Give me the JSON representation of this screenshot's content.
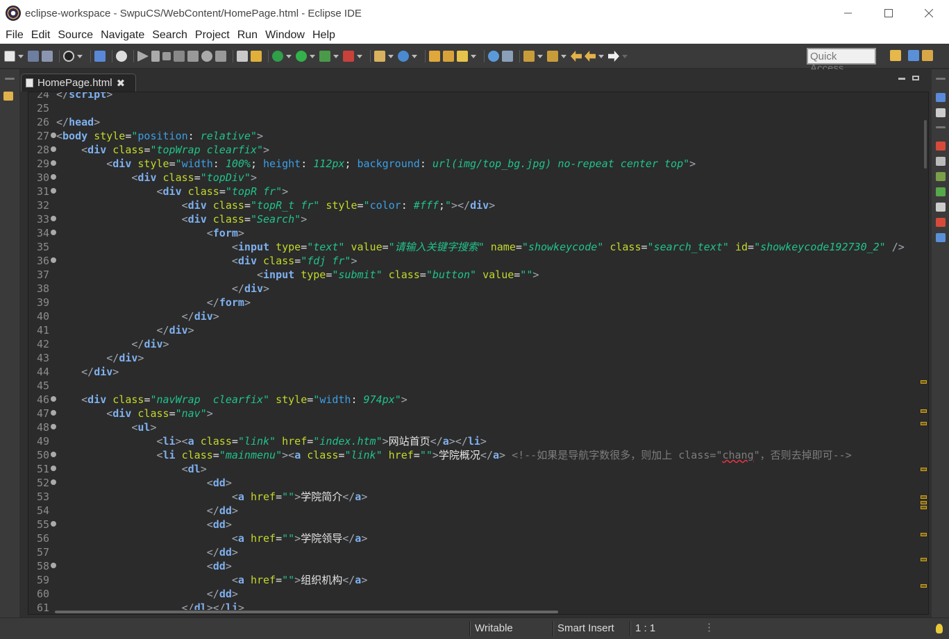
{
  "window": {
    "title": "eclipse-workspace - SwpuCS/WebContent/HomePage.html - Eclipse IDE",
    "icon": "eclipse-icon"
  },
  "menu": [
    "File",
    "Edit",
    "Source",
    "Navigate",
    "Search",
    "Project",
    "Run",
    "Window",
    "Help"
  ],
  "toolbar": {
    "quick_access_placeholder": "Quick Access"
  },
  "editor": {
    "tab_label": "HomePage.html",
    "tab_close": "✖",
    "lines": [
      {
        "n": "24",
        "fold": false,
        "html": "<span class='t'>&lt;/</span><span class='tn'>script</span><span class='t'>&gt;</span>"
      },
      {
        "n": "25",
        "fold": false,
        "html": ""
      },
      {
        "n": "26",
        "fold": false,
        "html": "<span class='t'>&lt;/</span><span class='tn'>head</span><span class='t'>&gt;</span>"
      },
      {
        "n": "27",
        "fold": true,
        "html": "<span class='t'>&lt;</span><span class='tn'>body</span> <span class='an'>style</span><span class='tx'>=</span><span class='av'>\"</span><span class='css'>position</span><span class='tx'>: </span><span class='av'>relative</span><span class='av'>\"</span><span class='t'>&gt;</span>"
      },
      {
        "n": "28",
        "fold": true,
        "html": "    <span class='t'>&lt;</span><span class='tn'>div</span> <span class='an'>class</span><span class='tx'>=</span><span class='av'>\"topWrap clearfix\"</span><span class='t'>&gt;</span>"
      },
      {
        "n": "29",
        "fold": true,
        "html": "        <span class='t'>&lt;</span><span class='tn'>div</span> <span class='an'>style</span><span class='tx'>=</span><span class='av'>\"</span><span class='css'>width</span><span class='tx'>: </span><span class='av'>100%</span><span class='tx'>; </span><span class='css'>height</span><span class='tx'>: </span><span class='av'>112px</span><span class='tx'>; </span><span class='css'>background</span><span class='tx'>: </span><span class='av'>url(img/top_bg.jpg) no-repeat center top</span><span class='av'>\"</span><span class='t'>&gt;</span>"
      },
      {
        "n": "30",
        "fold": true,
        "html": "            <span class='t'>&lt;</span><span class='tn'>div</span> <span class='an'>class</span><span class='tx'>=</span><span class='av'>\"topDiv\"</span><span class='t'>&gt;</span>"
      },
      {
        "n": "31",
        "fold": true,
        "html": "                <span class='t'>&lt;</span><span class='tn'>div</span> <span class='an'>class</span><span class='tx'>=</span><span class='av'>\"topR fr\"</span><span class='t'>&gt;</span>"
      },
      {
        "n": "32",
        "fold": false,
        "html": "                    <span class='t'>&lt;</span><span class='tn'>div</span> <span class='an'>class</span><span class='tx'>=</span><span class='av'>\"topR_t fr\"</span> <span class='an'>style</span><span class='tx'>=</span><span class='av'>\"</span><span class='css'>color</span><span class='tx'>: </span><span class='av'>#fff</span><span class='tx'>;</span><span class='av'>\"</span><span class='t'>&gt;&lt;/</span><span class='tn'>div</span><span class='t'>&gt;</span>"
      },
      {
        "n": "33",
        "fold": true,
        "html": "                    <span class='t'>&lt;</span><span class='tn'>div</span> <span class='an'>class</span><span class='tx'>=</span><span class='av'>\"Search\"</span><span class='t'>&gt;</span>"
      },
      {
        "n": "34",
        "fold": true,
        "html": "                        <span class='t'>&lt;</span><span class='tn'>form</span><span class='t'>&gt;</span>"
      },
      {
        "n": "35",
        "fold": false,
        "html": "                            <span class='t'>&lt;</span><span class='tn'>input</span> <span class='an'>type</span><span class='tx'>=</span><span class='av'>\"text\"</span> <span class='an'>value</span><span class='tx'>=</span><span class='av'>\"请输入关键字搜索\"</span> <span class='an'>name</span><span class='tx'>=</span><span class='av'>\"showkeycode\"</span> <span class='an'>class</span><span class='tx'>=</span><span class='av'>\"search_text\"</span> <span class='an'>id</span><span class='tx'>=</span><span class='av'>\"showkeycode192730_2\"</span> <span class='t'>/&gt;</span>"
      },
      {
        "n": "36",
        "fold": true,
        "html": "                            <span class='t'>&lt;</span><span class='tn'>div</span> <span class='an'>class</span><span class='tx'>=</span><span class='av'>\"fdj fr\"</span><span class='t'>&gt;</span>"
      },
      {
        "n": "37",
        "fold": false,
        "html": "                                <span class='t'>&lt;</span><span class='tn'>input</span> <span class='an'>type</span><span class='tx'>=</span><span class='av'>\"submit\"</span> <span class='an'>class</span><span class='tx'>=</span><span class='av'>\"button\"</span> <span class='an'>value</span><span class='tx'>=</span><span class='av'>\"\"</span><span class='t'>&gt;</span>"
      },
      {
        "n": "38",
        "fold": false,
        "html": "                            <span class='t'>&lt;/</span><span class='tn'>div</span><span class='t'>&gt;</span>"
      },
      {
        "n": "39",
        "fold": false,
        "html": "                        <span class='t'>&lt;/</span><span class='tn'>form</span><span class='t'>&gt;</span>"
      },
      {
        "n": "40",
        "fold": false,
        "html": "                    <span class='t'>&lt;/</span><span class='tn'>div</span><span class='t'>&gt;</span>"
      },
      {
        "n": "41",
        "fold": false,
        "html": "                <span class='t'>&lt;/</span><span class='tn'>div</span><span class='t'>&gt;</span>"
      },
      {
        "n": "42",
        "fold": false,
        "html": "            <span class='t'>&lt;/</span><span class='tn'>div</span><span class='t'>&gt;</span>"
      },
      {
        "n": "43",
        "fold": false,
        "html": "        <span class='t'>&lt;/</span><span class='tn'>div</span><span class='t'>&gt;</span>"
      },
      {
        "n": "44",
        "fold": false,
        "html": "    <span class='t'>&lt;/</span><span class='tn'>div</span><span class='t'>&gt;</span>"
      },
      {
        "n": "45",
        "fold": false,
        "html": ""
      },
      {
        "n": "46",
        "fold": true,
        "html": "    <span class='t'>&lt;</span><span class='tn'>div</span> <span class='an'>class</span><span class='tx'>=</span><span class='av'>\"navWrap  clearfix\"</span> <span class='an'>style</span><span class='tx'>=</span><span class='av'>\"</span><span class='css'>width</span><span class='tx'>: </span><span class='av'>974px</span><span class='av'>\"</span><span class='t'>&gt;</span>"
      },
      {
        "n": "47",
        "fold": true,
        "html": "        <span class='t'>&lt;</span><span class='tn'>div</span> <span class='an'>class</span><span class='tx'>=</span><span class='av'>\"nav\"</span><span class='t'>&gt;</span>"
      },
      {
        "n": "48",
        "fold": true,
        "html": "            <span class='t'>&lt;</span><span class='tn'>ul</span><span class='t'>&gt;</span>"
      },
      {
        "n": "49",
        "fold": false,
        "html": "                <span class='t'>&lt;</span><span class='tn'>li</span><span class='t'>&gt;&lt;</span><span class='tn'>a</span> <span class='an'>class</span><span class='tx'>=</span><span class='av'>\"link\"</span> <span class='an'>href</span><span class='tx'>=</span><span class='av'>\"index.htm\"</span><span class='t'>&gt;</span><span class='tx'>网站首页</span><span class='t'>&lt;/</span><span class='tn'>a</span><span class='t'>&gt;&lt;/</span><span class='tn'>li</span><span class='t'>&gt;</span>"
      },
      {
        "n": "50",
        "fold": true,
        "html": "                <span class='t'>&lt;</span><span class='tn'>li</span> <span class='an'>class</span><span class='tx'>=</span><span class='av'>\"mainmenu\"</span><span class='t'>&gt;&lt;</span><span class='tn'>a</span> <span class='an'>class</span><span class='tx'>=</span><span class='av'>\"link\"</span> <span class='an'>href</span><span class='tx'>=</span><span class='av'>\"\"</span><span class='t'>&gt;</span><span class='tx'>学院概况</span><span class='t'>&lt;/</span><span class='tn'>a</span><span class='t'>&gt;</span> <span class='cm'>&lt;!--如果是导航字数很多，则加上 class=\"<span class='sq'>chang</span>\"，否则去掉即可--&gt;</span>"
      },
      {
        "n": "51",
        "fold": true,
        "html": "                    <span class='t'>&lt;</span><span class='tn'>dl</span><span class='t'>&gt;</span>"
      },
      {
        "n": "52",
        "fold": true,
        "html": "                        <span class='t'>&lt;</span><span class='tn'>dd</span><span class='t'>&gt;</span>"
      },
      {
        "n": "53",
        "fold": false,
        "html": "                            <span class='t'>&lt;</span><span class='tn'>a</span> <span class='an'>href</span><span class='tx'>=</span><span class='av'>\"\"</span><span class='t'>&gt;</span><span class='tx'>学院简介</span><span class='t'>&lt;/</span><span class='tn'>a</span><span class='t'>&gt;</span>"
      },
      {
        "n": "54",
        "fold": false,
        "html": "                        <span class='t'>&lt;/</span><span class='tn'>dd</span><span class='t'>&gt;</span>"
      },
      {
        "n": "55",
        "fold": true,
        "html": "                        <span class='t'>&lt;</span><span class='tn'>dd</span><span class='t'>&gt;</span>"
      },
      {
        "n": "56",
        "fold": false,
        "html": "                            <span class='t'>&lt;</span><span class='tn'>a</span> <span class='an'>href</span><span class='tx'>=</span><span class='av'>\"\"</span><span class='t'>&gt;</span><span class='tx'>学院领导</span><span class='t'>&lt;/</span><span class='tn'>a</span><span class='t'>&gt;</span>"
      },
      {
        "n": "57",
        "fold": false,
        "html": "                        <span class='t'>&lt;/</span><span class='tn'>dd</span><span class='t'>&gt;</span>"
      },
      {
        "n": "58",
        "fold": true,
        "html": "                        <span class='t'>&lt;</span><span class='tn'>dd</span><span class='t'>&gt;</span>"
      },
      {
        "n": "59",
        "fold": false,
        "html": "                            <span class='t'>&lt;</span><span class='tn'>a</span> <span class='an'>href</span><span class='tx'>=</span><span class='av'>\"\"</span><span class='t'>&gt;</span><span class='tx'>组织机构</span><span class='t'>&lt;/</span><span class='tn'>a</span><span class='t'>&gt;</span>"
      },
      {
        "n": "60",
        "fold": false,
        "html": "                        <span class='t'>&lt;/</span><span class='tn'>dd</span><span class='t'>&gt;</span>"
      },
      {
        "n": "61",
        "fold": false,
        "html": "                    <span class='t'>&lt;/</span><span class='tn'>dl</span><span class='t'>&gt;&lt;/</span><span class='tn'>li</span><span class='t'>&gt;</span>"
      }
    ]
  },
  "statusbar": {
    "writable": "Writable",
    "insert_mode": "Smart Insert",
    "position": "1 : 1"
  },
  "colors": {
    "tag": "#7fb1f0",
    "attribute": "#c4d92a",
    "value": "#20c38a",
    "comment": "#7d7d7d",
    "background": "#2b2b2b"
  }
}
